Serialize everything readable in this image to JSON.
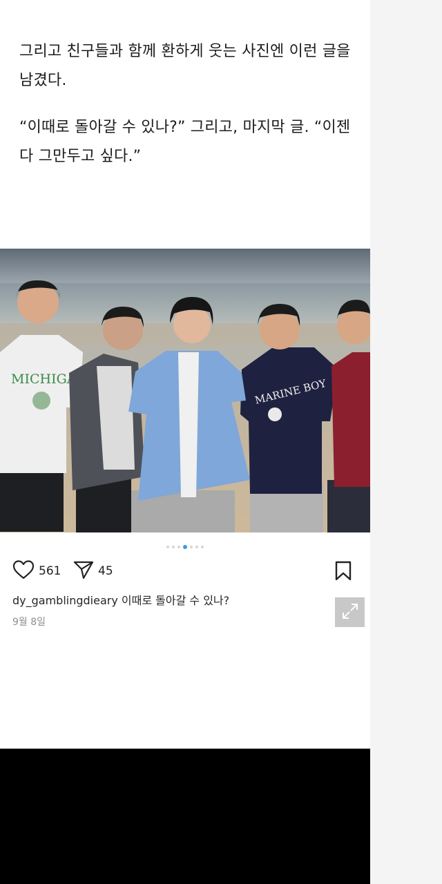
{
  "article": {
    "paragraph1": "그리고 친구들과 함께 환하게 웃는 사진엔 이런 글을 남겼다.",
    "paragraph2": "“이때로 돌아갈 수 있나?” 그리고, 마지막 글. “이젠 다 그만두고 싶다.”"
  },
  "post": {
    "photo_text": {
      "shirt1": "MICHIGAN",
      "shirt2": "MARINE BOY"
    },
    "carousel": {
      "count": 7,
      "active_index": 3
    },
    "likes": "561",
    "shares": "45",
    "username": "dy_gamblingdieary",
    "caption": "이때로 돌아갈 수 있나?",
    "date": "9월 8일"
  },
  "icons": {
    "like": "heart-icon",
    "share": "paper-plane-icon",
    "save": "bookmark-icon",
    "expand": "expand-arrows-icon"
  },
  "colors": {
    "accent": "#3b9ae1",
    "background": "#ffffff",
    "text": "#1c1c1c",
    "muted": "#8e8e8e"
  }
}
